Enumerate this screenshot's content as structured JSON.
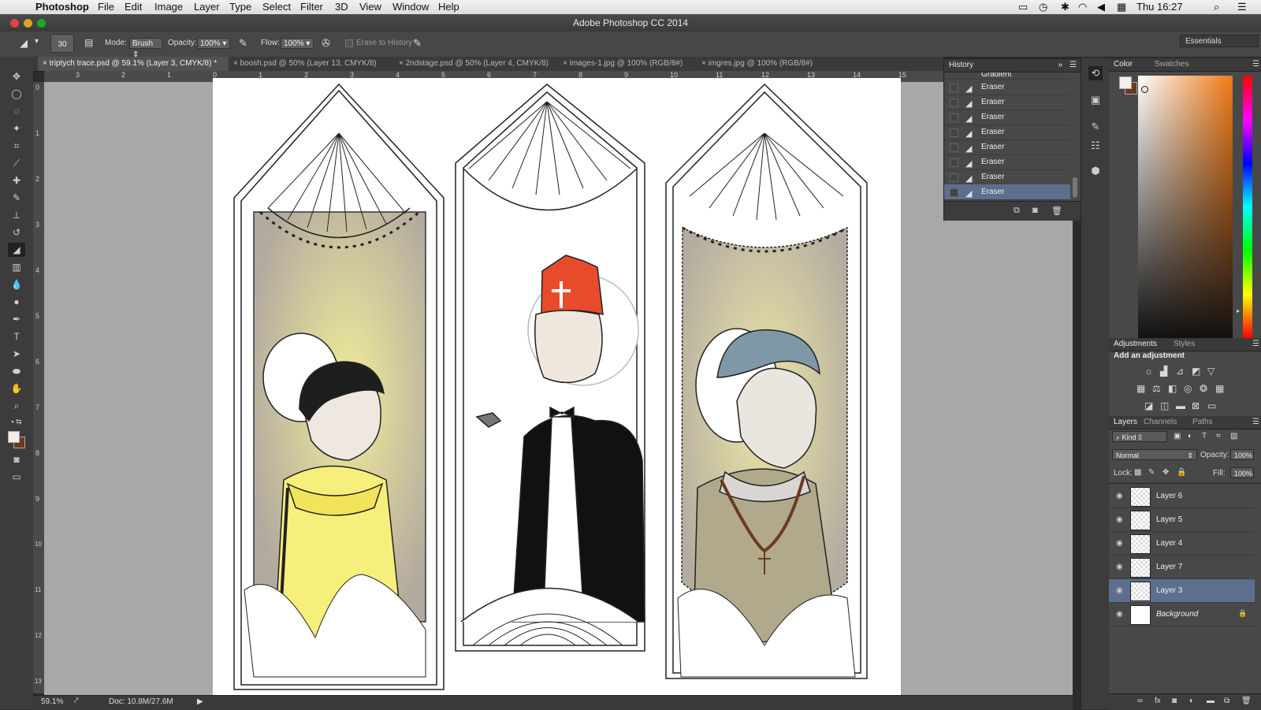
{
  "menubar": {
    "app_name": "Photoshop",
    "items": [
      "File",
      "Edit",
      "Image",
      "Layer",
      "Type",
      "Select",
      "Filter",
      "3D",
      "View",
      "Window",
      "Help"
    ],
    "clock": "Thu 16:27"
  },
  "window": {
    "title": "Adobe Photoshop CC 2014"
  },
  "options": {
    "brush_size": "30",
    "mode_label": "Mode:",
    "mode_value": "Brush",
    "opacity_label": "Opacity:",
    "opacity_value": "100%",
    "flow_label": "Flow:",
    "flow_value": "100%",
    "erase_history": "Erase to History",
    "workspace": "Essentials"
  },
  "tabs": [
    {
      "label": "triptych trace.psd @ 59.1% (Layer 3, CMYK/8) *"
    },
    {
      "label": "boosh.psd @ 50% (Layer 13, CMYK/8)"
    },
    {
      "label": "2ndstage.psd @ 50% (Layer 4, CMYK/8)"
    },
    {
      "label": "images-1.jpg @ 100% (RGB/8#)"
    },
    {
      "label": "imgres.jpg @ 100% (RGB/8#)"
    }
  ],
  "ruler": {
    "h_ticks": [
      "3",
      "2",
      "1",
      "0",
      "1",
      "2",
      "3",
      "4",
      "5",
      "6",
      "7",
      "8",
      "9",
      "10",
      "11",
      "12",
      "13",
      "14",
      "15"
    ],
    "v_ticks": [
      "0",
      "1",
      "2",
      "3",
      "4",
      "5",
      "6",
      "7",
      "8",
      "9",
      "10",
      "11",
      "12",
      "13"
    ]
  },
  "status": {
    "zoom": "59.1%",
    "doc": "Doc: 10.8M/27.6M"
  },
  "history": {
    "title": "History",
    "partial_item": "Gradient",
    "items": [
      "Eraser",
      "Eraser",
      "Eraser",
      "Eraser",
      "Eraser",
      "Eraser",
      "Eraser",
      "Eraser"
    ],
    "selected_index": 7
  },
  "color_panel": {
    "tabs": [
      "Color",
      "Swatches"
    ]
  },
  "adjustments": {
    "tabs": [
      "Adjustments",
      "Styles"
    ],
    "heading": "Add an adjustment"
  },
  "layers_panel": {
    "tabs": [
      "Layers",
      "Channels",
      "Paths"
    ],
    "filter": "Kind",
    "blend_mode": "Normal",
    "opacity_label": "Opacity:",
    "opacity_value": "100%",
    "lock_label": "Lock:",
    "fill_label": "Fill:",
    "fill_value": "100%",
    "layers": [
      {
        "name": "Layer 6"
      },
      {
        "name": "Layer 5"
      },
      {
        "name": "Layer 4"
      },
      {
        "name": "Layer 7"
      },
      {
        "name": "Layer 3"
      },
      {
        "name": "Background"
      }
    ],
    "selected_layer": "Layer 3"
  }
}
